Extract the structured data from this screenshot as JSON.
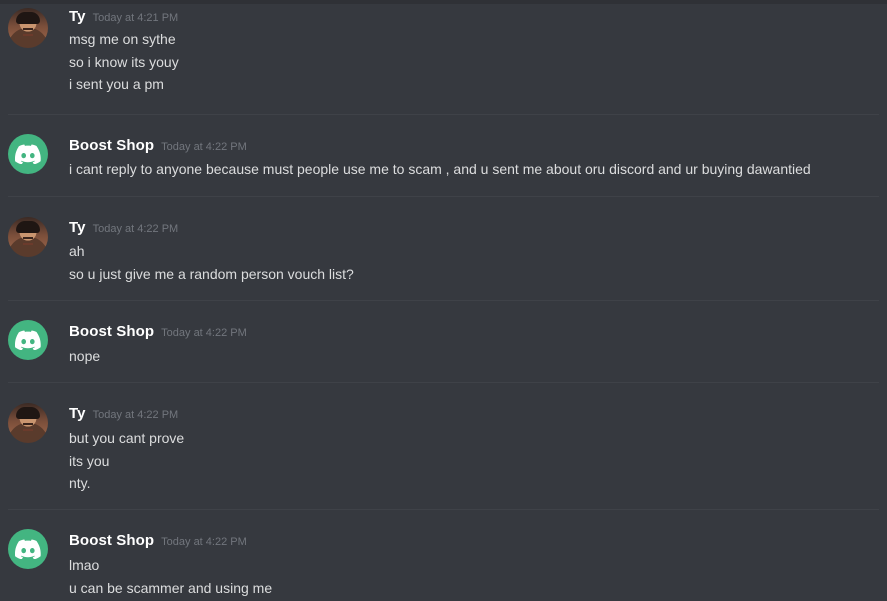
{
  "messages": [
    {
      "author": "Ty",
      "avatar": "user-avatar",
      "timestamp": "Today at 4:21 PM",
      "lines": [
        "msg me on sythe",
        "so i know its youy",
        "i sent you a pm"
      ]
    },
    {
      "author": "Boost Shop",
      "avatar": "discord-logo-icon",
      "timestamp": "Today at 4:22 PM",
      "lines": [
        "i cant reply to anyone because must people use me to scam , and u sent me about oru discord and ur buying dawantied"
      ]
    },
    {
      "author": "Ty",
      "avatar": "user-avatar",
      "timestamp": "Today at 4:22 PM",
      "lines": [
        "ah",
        "so u just give me a random person vouch list?"
      ]
    },
    {
      "author": "Boost Shop",
      "avatar": "discord-logo-icon",
      "timestamp": "Today at 4:22 PM",
      "lines": [
        "nope"
      ]
    },
    {
      "author": "Ty",
      "avatar": "user-avatar",
      "timestamp": "Today at 4:22 PM",
      "lines": [
        "but you cant prove",
        "its you",
        "nty."
      ]
    },
    {
      "author": "Boost Shop",
      "avatar": "discord-logo-icon",
      "timestamp": "Today at 4:22 PM",
      "lines": [
        "lmao",
        "u can be scammer and using me"
      ]
    }
  ],
  "colors": {
    "background": "#36393f",
    "bot_avatar": "#43b581",
    "username": "#ffffff",
    "timestamp": "#72767d",
    "message_text": "#dcddde"
  }
}
